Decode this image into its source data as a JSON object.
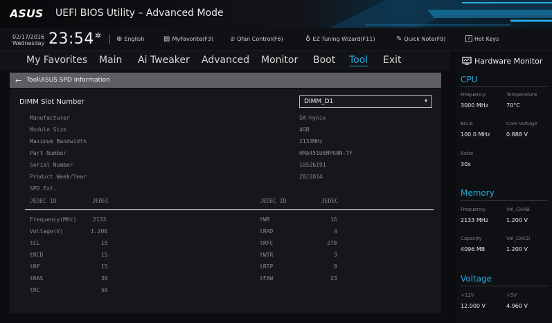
{
  "titlebar": {
    "logo_text": "ASUS",
    "title": "UEFI BIOS Utility – Advanced Mode"
  },
  "statusbar": {
    "date": "02/17/2016",
    "day": "Wednesday",
    "time": "23:54",
    "language": "English",
    "myfavorite": "MyFavorite(F3)",
    "qfan": "Qfan Control(F6)",
    "eztuning": "EZ Tuning Wizard(F11)",
    "quicknote": "Quick Note(F9)",
    "hotkeys": "Hot Keys",
    "hotkeys_key": "?"
  },
  "menu": {
    "items": [
      "My Favorites",
      "Main",
      "Ai Tweaker",
      "Advanced",
      "Monitor",
      "Boot",
      "Tool",
      "Exit"
    ],
    "active": "Tool"
  },
  "breadcrumb": "Tool\\ASUS SPD Information",
  "dimm": {
    "label": "DIMM Slot Number",
    "selected": "DIMM_D1"
  },
  "info": [
    {
      "label": "Manufacturer",
      "value": "SK-Hynix"
    },
    {
      "label": "Module Size",
      "value": "4GB"
    },
    {
      "label": "Maximum Bandwidth",
      "value": "2133MHz"
    },
    {
      "label": "Part Number",
      "value": "HMA451U6MFR8N-TF"
    },
    {
      "label": "Serial Number",
      "value": "1052b191"
    },
    {
      "label": "Product Week/Year",
      "value": "28/2014"
    },
    {
      "label": "SPD Ext.",
      "value": ""
    }
  ],
  "timings": {
    "left_headers": [
      "JEDEC ID",
      "JEDEC"
    ],
    "right_headers": [
      "JEDEC ID",
      "JEDEC"
    ],
    "left": [
      {
        "name": "Frequency(MHz)",
        "value": "2133"
      },
      {
        "name": "Voltage(V)",
        "value": "1.200"
      },
      {
        "name": "tCL",
        "value": "15"
      },
      {
        "name": "tRCD",
        "value": "15"
      },
      {
        "name": "tRP",
        "value": "15"
      },
      {
        "name": "tRAS",
        "value": "36"
      },
      {
        "name": "tRC",
        "value": "50"
      }
    ],
    "right": [
      {
        "name": "tWR",
        "value": "16"
      },
      {
        "name": "tRRD",
        "value": "4"
      },
      {
        "name": "tRFC",
        "value": "278"
      },
      {
        "name": "tWTR",
        "value": "3"
      },
      {
        "name": "tRTP",
        "value": "8"
      },
      {
        "name": "tFAW",
        "value": "23"
      }
    ]
  },
  "hwmon": {
    "title": "Hardware Monitor",
    "cpu": {
      "title": "CPU",
      "frequency_label": "Frequency",
      "frequency": "3000 MHz",
      "temperature_label": "Temperature",
      "temperature": "70°C",
      "bclk_label": "BCLK",
      "bclk": "100.0 MHz",
      "core_voltage_label": "Core Voltage",
      "core_voltage": "0.888 V",
      "ratio_label": "Ratio",
      "ratio": "30x"
    },
    "memory": {
      "title": "Memory",
      "frequency_label": "Frequency",
      "frequency": "2133 MHz",
      "vol_chab_label": "Vol_CHAB",
      "vol_chab": "1.200 V",
      "capacity_label": "Capacity",
      "capacity": "4096 MB",
      "vol_chcd_label": "Vol_CHCD",
      "vol_chcd": "1.200 V"
    },
    "voltage": {
      "title": "Voltage",
      "v12_label": "+12V",
      "v12": "12.000 V",
      "v5_label": "+5V",
      "v5": "4.960 V"
    }
  },
  "colors": {
    "accent": "#2aa9e0",
    "breadcrumb_bg": "#5d5e62",
    "content_bg": "#16171b"
  }
}
